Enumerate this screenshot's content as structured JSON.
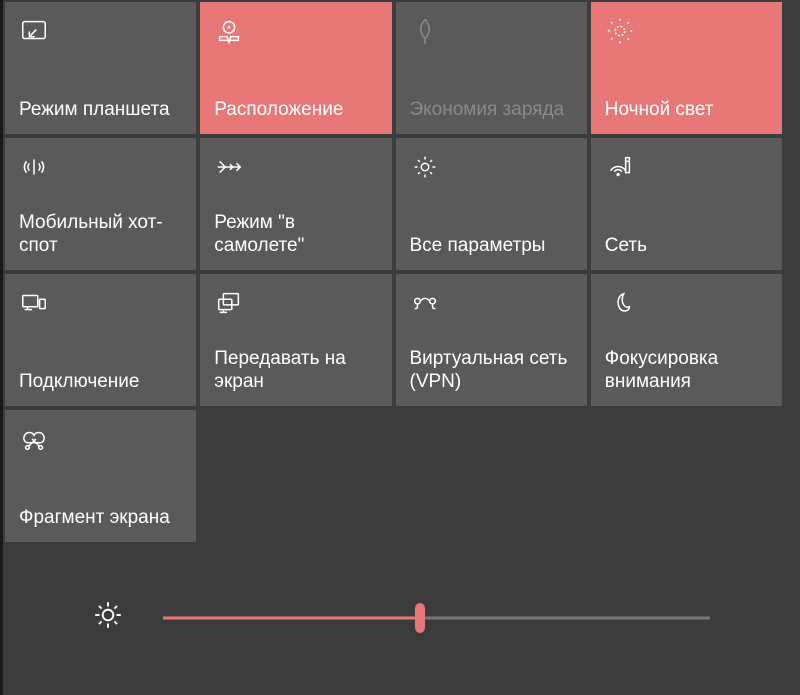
{
  "tiles": [
    {
      "id": "tablet-mode",
      "label": "Режим планшета",
      "active": false,
      "dim": false
    },
    {
      "id": "location",
      "label": "Расположение",
      "active": true,
      "dim": false
    },
    {
      "id": "battery-saver",
      "label": "Экономия заряда",
      "active": false,
      "dim": true
    },
    {
      "id": "night-light",
      "label": "Ночной свет",
      "active": true,
      "dim": false
    },
    {
      "id": "mobile-hotspot",
      "label": "Мобильный хот-спот",
      "active": false,
      "dim": false
    },
    {
      "id": "airplane-mode",
      "label": "Режим \"в самолете\"",
      "active": false,
      "dim": false
    },
    {
      "id": "all-settings",
      "label": "Все параметры",
      "active": false,
      "dim": false
    },
    {
      "id": "network",
      "label": "Сеть",
      "active": false,
      "dim": false
    },
    {
      "id": "connect",
      "label": "Подключение",
      "active": false,
      "dim": false
    },
    {
      "id": "project",
      "label": "Передавать на экран",
      "active": false,
      "dim": false
    },
    {
      "id": "vpn",
      "label": "Виртуальная сеть (VPN)",
      "active": false,
      "dim": false
    },
    {
      "id": "focus-assist",
      "label": "Фокусировка внимания",
      "active": false,
      "dim": false
    },
    {
      "id": "screen-snip",
      "label": "Фрагмент экрана",
      "active": false,
      "dim": false
    }
  ],
  "brightness": {
    "value": 47
  }
}
